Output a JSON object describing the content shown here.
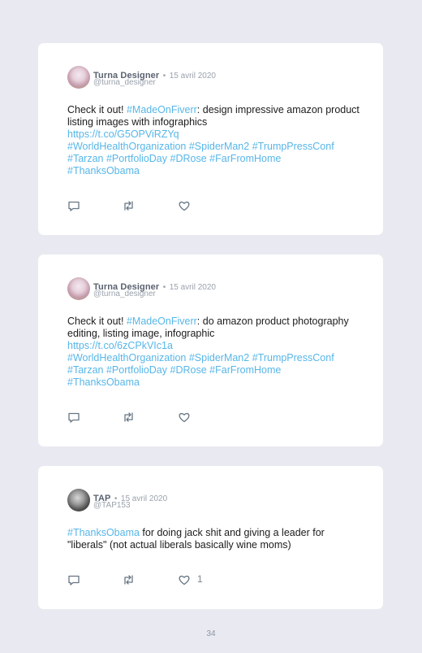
{
  "colors": {
    "background": "#e9eaf1",
    "card": "#ffffff",
    "link": "#57b6e8",
    "name": "#5a6270",
    "meta": "#9aa2ad"
  },
  "tweets": [
    {
      "author": {
        "name": "Turna Designer",
        "separator": "•",
        "date": "15 avril 2020",
        "handle": "@turna_designer",
        "avatar_icon": "profile-photo"
      },
      "text_pre": "Check it out! ",
      "text_tag1": "#MadeOnFiverr",
      "text_post": ": design impressive amazon product listing images with infographics",
      "url": "https://t.co/G5OPViRZYq",
      "hashtags_line1": [
        "#WorldHealthOrganization",
        "#SpiderMan2",
        "#TrumpPressConf"
      ],
      "hashtags_line2": [
        "#Tarzan",
        "#PortfolioDay",
        "#DRose",
        "#FarFromHome"
      ],
      "hashtags_line3": [
        "#ThanksObama"
      ],
      "likes": ""
    },
    {
      "author": {
        "name": "Turna Designer",
        "separator": "•",
        "date": "15 avril 2020",
        "handle": "@turna_designer",
        "avatar_icon": "profile-photo"
      },
      "text_pre": "Check it out! ",
      "text_tag1": "#MadeOnFiverr",
      "text_post": ": do amazon product photography editing, listing image, infographic",
      "url": "https://t.co/6zCPkVIc1a",
      "hashtags_line1": [
        "#WorldHealthOrganization",
        "#SpiderMan2",
        "#TrumpPressConf"
      ],
      "hashtags_line2": [
        "#Tarzan",
        "#PortfolioDay",
        "#DRose",
        "#FarFromHome"
      ],
      "hashtags_line3": [
        "#ThanksObama"
      ],
      "likes": ""
    },
    {
      "author": {
        "name": "TAP",
        "separator": "•",
        "date": "15 avril 2020",
        "handle": "@TAP153",
        "avatar_icon": "profile-photo"
      },
      "text_tag1": "#ThanksObama",
      "text_post": " for doing jack shit and giving a leader for \"liberals\" (not actual liberals basically wine moms)",
      "likes": "1"
    }
  ],
  "icons": {
    "reply": "reply-icon",
    "retweet": "retweet-icon",
    "like": "heart-icon"
  },
  "page_number": "34"
}
